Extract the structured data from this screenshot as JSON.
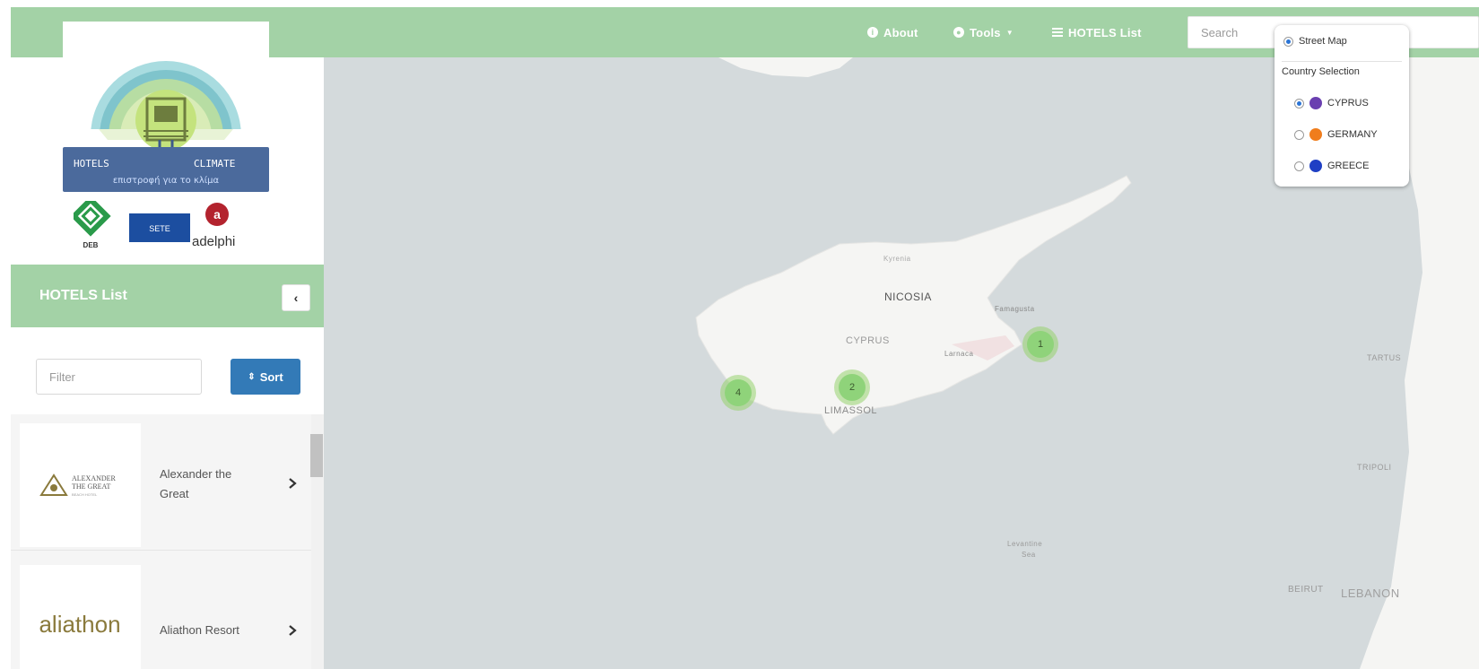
{
  "navbar": {
    "about_label": "About",
    "tools_label": "Tools",
    "hotels_list_label": "HOTELS List",
    "search_placeholder": "Search"
  },
  "logo": {
    "name_left": "HOTELS",
    "name_right": "CLIMATE",
    "tagline": "επιστροφή για το κλίμα"
  },
  "partners": {
    "deb_label": "DEB",
    "sete_label": "SETE",
    "adelphi_label": "adelphi"
  },
  "sidebar": {
    "title": "HOTELS List",
    "filter_placeholder": "Filter",
    "sort_label": "Sort",
    "hotels": [
      {
        "name": "Alexander the Great",
        "logo_line1": "ALEXANDER",
        "logo_line2": "THE GREAT",
        "logo_line3": "BEACH HOTEL"
      },
      {
        "name": "Aliathon Resort",
        "logo_text": "aliathon"
      }
    ]
  },
  "map": {
    "labels": {
      "nicosia": "NICOSIA",
      "cyprus": "CYPRUS",
      "limassol": "LIMASSOL",
      "larnaca": "Larnaca",
      "famagusta": "Famagusta",
      "kyrenia": "Kyrenia",
      "levantine_line1": "Levantine",
      "levantine_line2": "Sea",
      "tartus": "TARTUS",
      "tripoli": "TRIPOLI",
      "beirut": "BEIRUT",
      "lebanon": "LEBANON"
    },
    "clusters": [
      {
        "count": "4"
      },
      {
        "count": "2"
      },
      {
        "count": "1"
      }
    ]
  },
  "layer_control": {
    "street_map_label": "Street Map",
    "country_selection_label": "Country Selection",
    "countries": [
      {
        "name": "CYPRUS",
        "color": "#6a3fb0",
        "selected": true
      },
      {
        "name": "GERMANY",
        "color": "#f07d1c",
        "selected": false
      },
      {
        "name": "GREECE",
        "color": "#1f3fc4",
        "selected": false
      }
    ]
  },
  "colors": {
    "navbar": "#a3d2a6",
    "sort_button": "#337ab7",
    "cluster": "#8fd37a",
    "map_sea": "#d4dadc",
    "map_land": "#f5f5f3"
  }
}
